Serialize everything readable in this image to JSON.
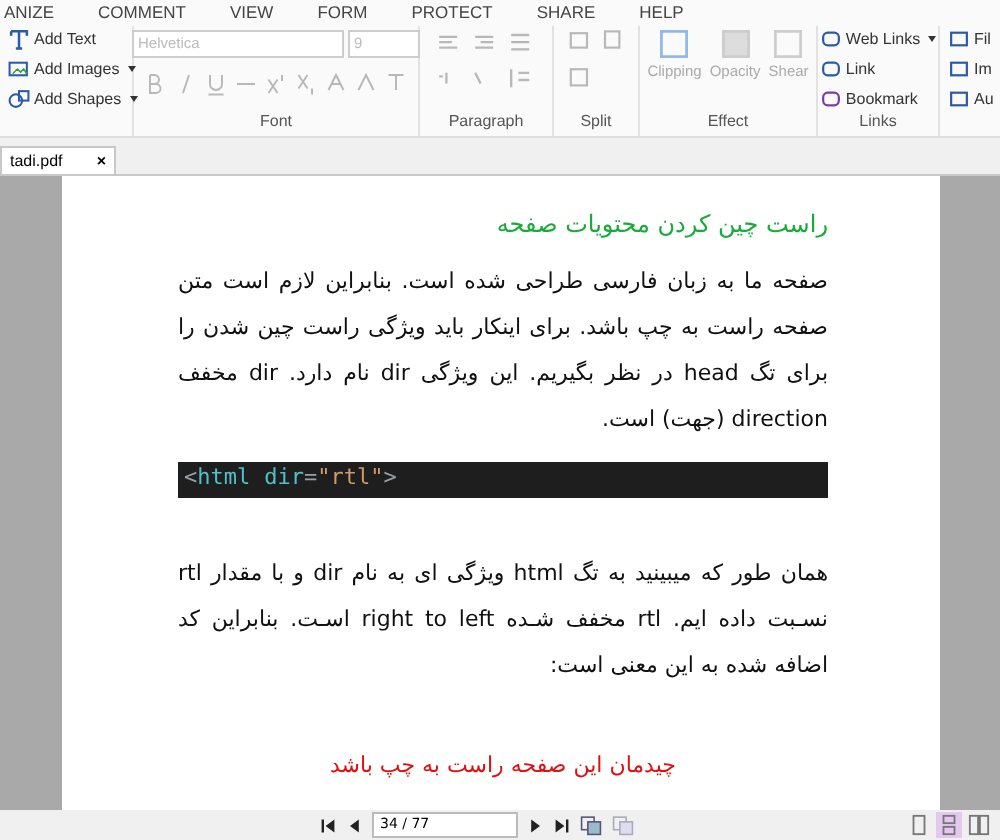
{
  "menu": [
    "ANIZE",
    "COMMENT",
    "VIEW",
    "FORM",
    "PROTECT",
    "SHARE",
    "HELP"
  ],
  "ribbon": {
    "insert": [
      "Add Text",
      "Add Images",
      "Add Shapes"
    ],
    "font": {
      "label": "Font",
      "family": "Helvetica",
      "size": "9",
      "disabled": true
    },
    "paragraph": {
      "label": "Paragraph"
    },
    "split": {
      "label": "Split"
    },
    "effect": {
      "label": "Effect",
      "tools": [
        "Clipping",
        "Opacity",
        "Shear"
      ]
    },
    "links": {
      "label": "Links",
      "tools": [
        "Web Links",
        "Link",
        "Bookmark"
      ]
    },
    "more": [
      "Fil",
      "Im",
      "Au"
    ]
  },
  "tab": {
    "title": "tadi.pdf",
    "close": "×"
  },
  "document": {
    "heading": "راست چین کردن محتویات صفحه",
    "paragraph_1": "صفحه ما به زبان فارسی طراحی شده است. بنابراین لازم است متن صفحه راست به چپ باشد. برای اینکار باید ویژگی راست چین شدن را برای تگ head در نظر بگیریم.  این ویژگی dir نام دارد. dir مخفف direction (جهت) است.",
    "code": [
      {
        "text": "<",
        "kind": "punct"
      },
      {
        "text": "html",
        "kind": "tag"
      },
      {
        "text": "dir",
        "kind": "attr"
      },
      {
        "text": "=",
        "kind": "punct"
      },
      {
        "text": "\"rtl\"",
        "kind": "string"
      },
      {
        "text": ">",
        "kind": "punct"
      }
    ],
    "paragraph_2": "همان طور که میبینید به تگ html ویژگی ای به نام dir و با مقدار rtl نسـبت داده ایم. rtl مخفف شـده right to left اسـت. بنابراین کد اضافه شده به این معنی است:",
    "note": "چیدمان این صفحه راست به چپ باشد"
  },
  "status_bar": {
    "page": "34 / 77",
    "views": [
      {
        "kind": "single",
        "selected": false
      },
      {
        "kind": "continuous",
        "selected": true
      },
      {
        "kind": "facing",
        "selected": false
      }
    ]
  }
}
